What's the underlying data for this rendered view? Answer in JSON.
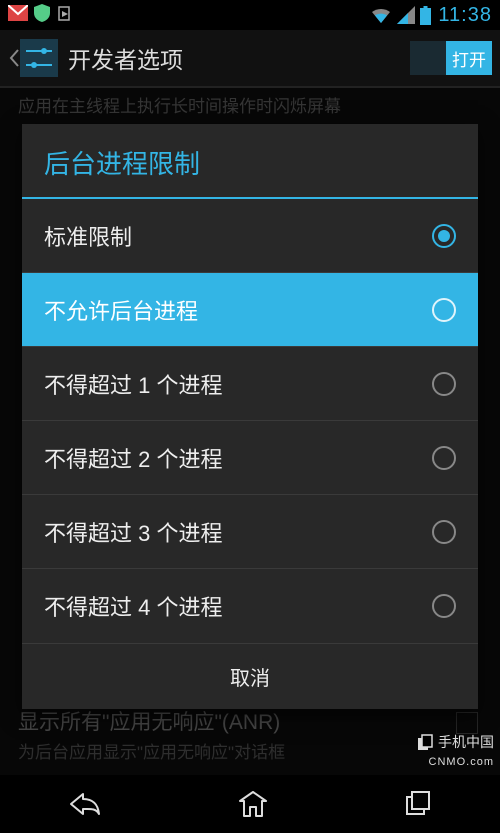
{
  "status": {
    "time": "11:38"
  },
  "appbar": {
    "title": "开发者选项",
    "toggle_label": "打开"
  },
  "bg": {
    "top_subtext": "应用在主线程上执行长时间操作时闪烁屏幕",
    "anr_title": "显示所有\"应用无响应\"(ANR)",
    "anr_sub": "为后台应用显示\"应用无响应\"对话框"
  },
  "dialog": {
    "title": "后台进程限制",
    "options": [
      {
        "label": "标准限制",
        "selected": true,
        "highlight": false
      },
      {
        "label": "不允许后台进程",
        "selected": false,
        "highlight": true
      },
      {
        "label": "不得超过 1 个进程",
        "selected": false,
        "highlight": false
      },
      {
        "label": "不得超过 2 个进程",
        "selected": false,
        "highlight": false
      },
      {
        "label": "不得超过 3 个进程",
        "selected": false,
        "highlight": false
      },
      {
        "label": "不得超过 4 个进程",
        "selected": false,
        "highlight": false
      }
    ],
    "cancel": "取消"
  },
  "watermark": {
    "line1": "手机中国",
    "line2": "CNMO.com"
  }
}
